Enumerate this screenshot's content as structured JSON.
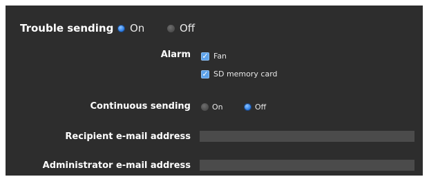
{
  "trouble_sending": {
    "label": "Trouble sending",
    "options": [
      {
        "label": "On",
        "selected": true
      },
      {
        "label": "Off",
        "selected": false
      }
    ]
  },
  "alarm": {
    "label": "Alarm",
    "checks": [
      {
        "label": "Fan",
        "checked": true
      },
      {
        "label": "SD memory card",
        "checked": true
      }
    ]
  },
  "continuous_sending": {
    "label": "Continuous sending",
    "options": [
      {
        "label": "On",
        "selected": false
      },
      {
        "label": "Off",
        "selected": true
      }
    ]
  },
  "recipient_email": {
    "label": "Recipient e-mail address",
    "value": ""
  },
  "admin_email": {
    "label": "Administrator e-mail address",
    "value": ""
  },
  "colors": {
    "panel": "#2d2d2d",
    "radio_selected": "#2f7fe6",
    "field_bg": "#4b4b4b"
  }
}
